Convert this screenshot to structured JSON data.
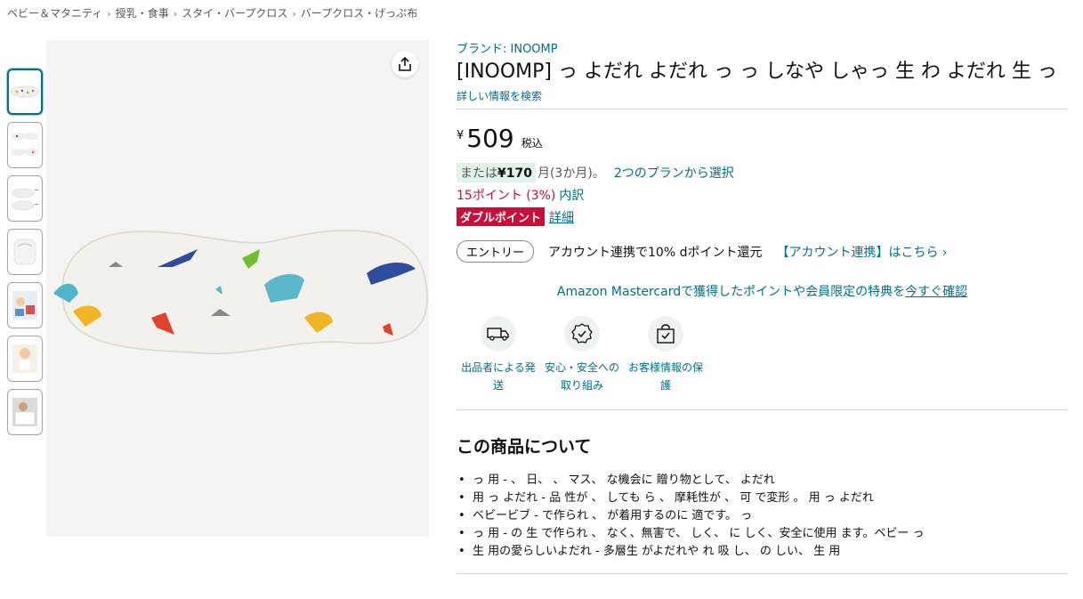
{
  "breadcrumb": [
    "ベビー＆マタニティ",
    "授乳・食事",
    "スタイ・バープクロス",
    "バープクロス・げっぷ布"
  ],
  "breadcrumb_separator": "›",
  "thumbnails_count": 7,
  "brand_link": "ブランド: INOOMP",
  "title": "[INOOMP] っ よだれ よだれ っ っ しなや しゃっ 生 わ よだれ 生 っ",
  "search_more": "詳しい情報を検索",
  "price": {
    "symbol": "¥",
    "value": "509",
    "tax": "税込"
  },
  "installment": {
    "prefix": "または",
    "amount": "¥170",
    "months": "月(3か月)。",
    "link": "2つのプランから選択"
  },
  "points": {
    "text": "15ポイント (3%)",
    "detail": "内訳"
  },
  "double_point": {
    "badge": "ダブルポイント",
    "link": "詳細"
  },
  "entry": {
    "button": "エントリー",
    "text": "アカウント連携で10% dポイント還元",
    "link": "【アカウント連携】はこちら ›"
  },
  "mastercard": {
    "text": "Amazon Mastercardで獲得したポイントや会員限定の特典を",
    "link": "今すぐ確認"
  },
  "features": [
    {
      "icon": "truck-icon",
      "label": "出品者による発送"
    },
    {
      "icon": "shield-badge-icon",
      "label": "安心・安全への取り組み"
    },
    {
      "icon": "secure-bag-icon",
      "label": "お客様情報の保護"
    }
  ],
  "about": {
    "title": "この商品について",
    "bullets": [
      "っ 用 - 、 日、 、 マス、 な機会に 贈り物として、 よだれ",
      "用 っ よだれ - 品 性が 、 しても ら 、 摩耗性が 、 可 で変形 。 用 っ よだれ",
      "ベビービブ - で作られ 、 が着用するのに 適です。 っ",
      "っ 用 - の 生 で作られ 、 なく、無害で、 しく、 に しく、安全に使用 ます。ベビー っ",
      "生 用の愛らしいよだれ - 多層生 がよだれや れ 吸 し、 の しい、 生 用"
    ]
  },
  "colors": {
    "link": "#007185",
    "deal_red": "#cc0c39",
    "installment_bg": "#dff3e8"
  }
}
